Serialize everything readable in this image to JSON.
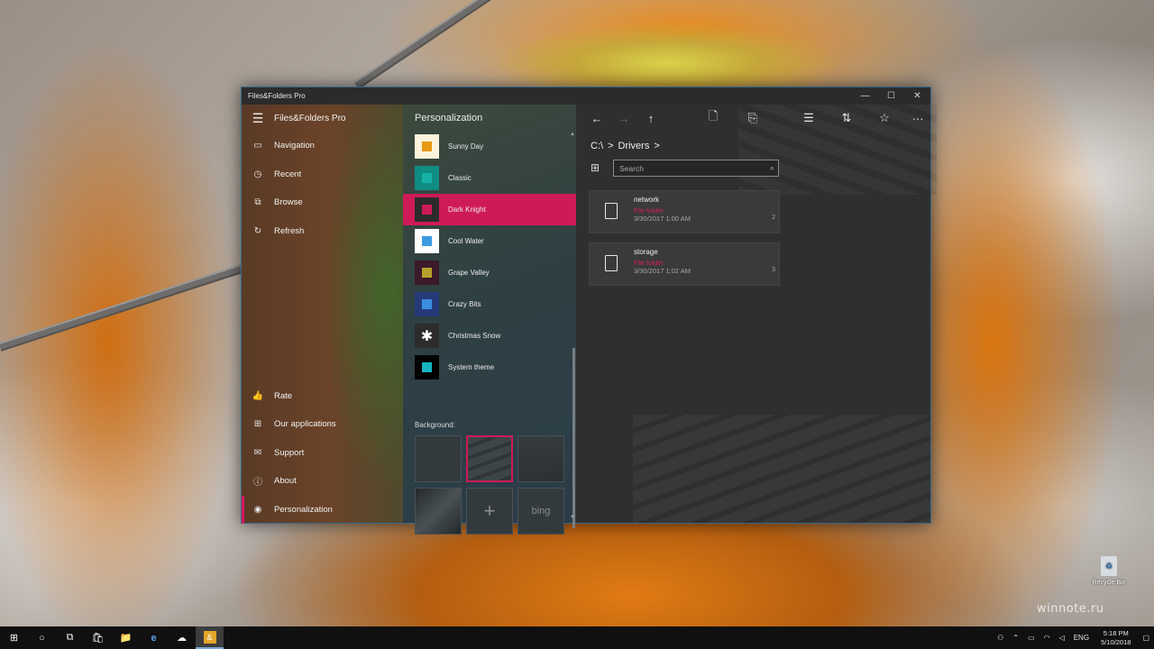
{
  "window": {
    "title": "Files&Folders Pro",
    "minimize": "—",
    "maximize": "☐",
    "close": "✕"
  },
  "nav": {
    "menu_icon": "☰",
    "app_name": "Files&Folders Pro",
    "items": [
      {
        "label": "Navigation",
        "icon": "laptop-icon",
        "glyph": "▭"
      },
      {
        "label": "Recent",
        "icon": "clock-icon",
        "glyph": "◷"
      },
      {
        "label": "Browse",
        "icon": "browse-icon",
        "glyph": "⧉"
      },
      {
        "label": "Refresh",
        "icon": "refresh-icon",
        "glyph": "↻"
      },
      {
        "label": "Rate",
        "icon": "thumbs-up-icon",
        "glyph": "👍"
      },
      {
        "label": "Our applications",
        "icon": "apps-icon",
        "glyph": "⊞"
      },
      {
        "label": "Support",
        "icon": "mail-icon",
        "glyph": "✉"
      },
      {
        "label": "About",
        "icon": "info-icon",
        "glyph": "ⓘ"
      },
      {
        "label": "Personalization",
        "icon": "palette-icon",
        "glyph": "◉"
      }
    ]
  },
  "personalization": {
    "title": "Personalization",
    "themes": [
      {
        "label": "Sunny Day",
        "bg": "#fbf3dc",
        "fg": "#e79a15"
      },
      {
        "label": "Classic",
        "bg": "#0f8c84",
        "fg": "#16b1a6"
      },
      {
        "label": "Dark Knight",
        "bg": "#2b2b2b",
        "fg": "#cf1a58"
      },
      {
        "label": "Cool Water",
        "bg": "#ffffff",
        "fg": "#3a9be0"
      },
      {
        "label": "Grape Valley",
        "bg": "#3b1a2a",
        "fg": "#b8a12a"
      },
      {
        "label": "Crazy Bits",
        "bg": "#263a7a",
        "fg": "#3c8ee0"
      },
      {
        "label": "Christmas Snow",
        "bg": "#2c2c2c",
        "fg": "#ffffff",
        "glyph": "✱"
      },
      {
        "label": "System theme",
        "bg": "#000000",
        "fg": "#15b5c2"
      }
    ],
    "selected_theme": "Dark Knight",
    "background_label": "Background:",
    "bg_tiles": [
      "",
      "",
      "",
      "",
      "+",
      "bing"
    ]
  },
  "toolbar": {
    "back": "←",
    "forward": "→",
    "up": "↑",
    "new_file": "🗋",
    "new_folder": "⎘",
    "select": "☰",
    "sort": "⇅",
    "favorite": "☆",
    "more": "···"
  },
  "breadcrumb": {
    "root": "C:\\",
    "sep": ">",
    "folder": "Drivers",
    "trail": ">"
  },
  "search": {
    "placeholder": "Search",
    "icon": "⌕"
  },
  "files": [
    {
      "name": "network",
      "type": "File folder",
      "date": "3/30/2017 1:00 AM",
      "count": "2"
    },
    {
      "name": "storage",
      "type": "File folder",
      "date": "3/30/2017 1:02 AM",
      "count": "3"
    }
  ],
  "desktop": {
    "recycle_bin": "Recycle Bin",
    "watermark": "winnote.ru"
  },
  "taskbar": {
    "start": "⊞",
    "search": "○",
    "task_view": "⧉",
    "store": "🛍",
    "explorer": "📁",
    "edge": "e",
    "app2": "☁",
    "active_app": "&",
    "tray_people": "⚇",
    "tray_up": "⌃",
    "tray_battery": "▭",
    "tray_wifi": "◠",
    "tray_volume": "◁",
    "tray_lang": "ENG",
    "time": "5:18 PM",
    "date": "5/10/2018",
    "notifications": "▢"
  }
}
